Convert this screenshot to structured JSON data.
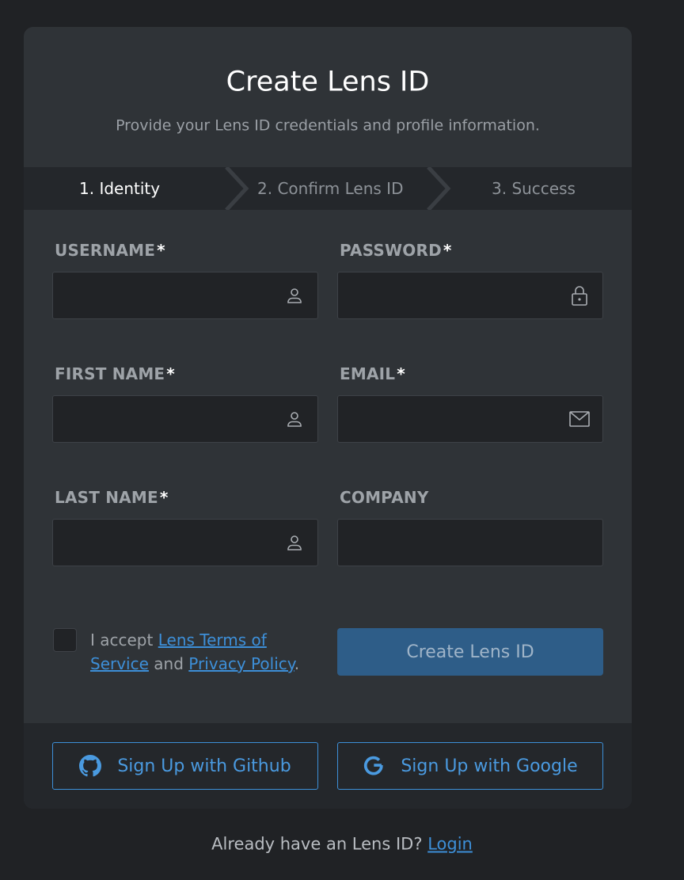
{
  "title": "Create Lens ID",
  "subtitle": "Provide your Lens ID credentials and profile information.",
  "steps": [
    {
      "label": "1. Identity",
      "active": true
    },
    {
      "label": "2. Confirm Lens ID",
      "active": false
    },
    {
      "label": "3. Success",
      "active": false
    }
  ],
  "fields": {
    "username": {
      "label": "USERNAME",
      "required": "*",
      "value": "",
      "icon": "user-icon"
    },
    "password": {
      "label": "PASSWORD",
      "required": "*",
      "value": "",
      "icon": "lock-icon"
    },
    "first_name": {
      "label": "FIRST NAME",
      "required": "*",
      "value": "",
      "icon": "user-icon"
    },
    "email": {
      "label": "EMAIL",
      "required": "*",
      "value": "",
      "icon": "mail-icon"
    },
    "last_name": {
      "label": "LAST NAME",
      "required": "*",
      "value": "",
      "icon": "user-icon"
    },
    "company": {
      "label": "COMPANY",
      "value": ""
    }
  },
  "terms": {
    "prefix": "I accept",
    "link1": "Lens Terms of Service",
    "middle": "and",
    "link2": "Privacy Policy",
    "suffix": ".",
    "checked": false
  },
  "create_button": "Create Lens ID",
  "social": {
    "github": {
      "label": "Sign Up with Github",
      "icon": "github-icon"
    },
    "google": {
      "label": "Sign Up with Google",
      "icon": "google-icon"
    }
  },
  "footer": {
    "text": "Already have an Lens ID?",
    "login_link": "Login"
  },
  "colors": {
    "page_bg": "#202225",
    "card_bg": "#2f3337",
    "accent": "#3d8fd8",
    "button_bg": "#2e5d88"
  }
}
